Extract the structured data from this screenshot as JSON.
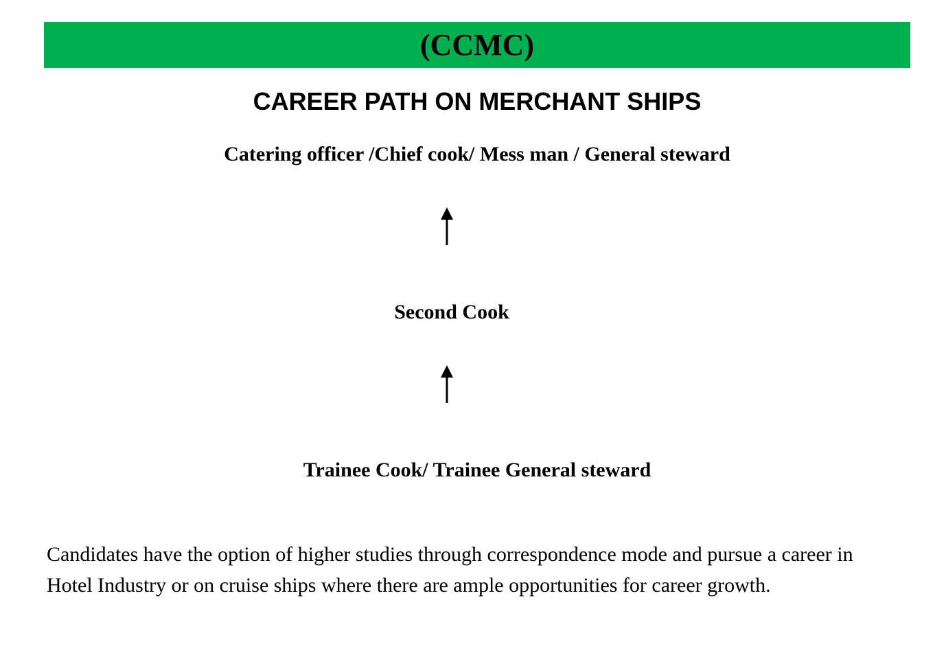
{
  "banner": {
    "title": "(CCMC)",
    "color": "#00b050"
  },
  "heading": "CAREER PATH ON MERCHANT SHIPS",
  "career_path": {
    "levels": [
      {
        "label": "Catering officer /Chief cook/ Mess man / General steward"
      },
      {
        "label": "Second Cook"
      },
      {
        "label": "Trainee Cook/ Trainee General steward"
      }
    ],
    "connector_icon": "up-arrow-icon"
  },
  "note": "Candidates have the option of  higher studies through correspondence mode and pursue a career in Hotel Industry or on cruise ships where there are ample opportunities for career growth."
}
